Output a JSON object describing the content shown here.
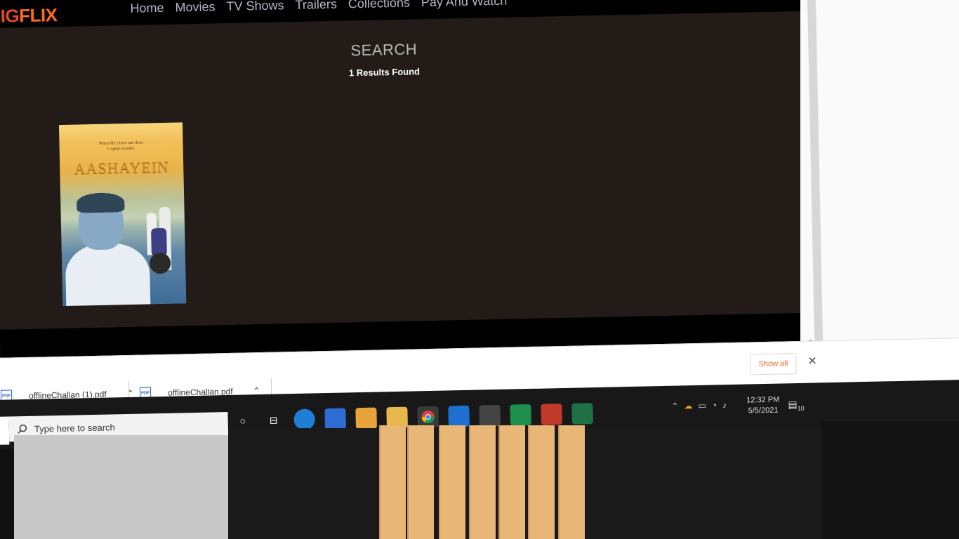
{
  "site": {
    "logo_part1": "IG",
    "logo_part2": "FLIX",
    "nav": [
      "Home",
      "Movies",
      "TV Shows",
      "Trailers",
      "Collections",
      "Pay And Watch"
    ]
  },
  "search": {
    "title": "SEARCH",
    "results": "1 Results Found"
  },
  "result": {
    "poster_tagline_line1": "When life closes one door,",
    "poster_tagline_line2": "it opens another.",
    "poster_title": "AASHAYEIN"
  },
  "downloads": {
    "items": [
      {
        "name": "offlineChallan (1).pdf"
      },
      {
        "name": "offlineChallan.pdf"
      }
    ],
    "show_all": "Show all"
  },
  "taskbar": {
    "search_placeholder": "Type here to search",
    "time": "12:32 PM",
    "date": "5/5/2021",
    "notifications": "10"
  },
  "colors": {
    "logo_orange": "#ff6a21",
    "content_bg": "#221b18",
    "show_all_text": "#ee6b20"
  }
}
